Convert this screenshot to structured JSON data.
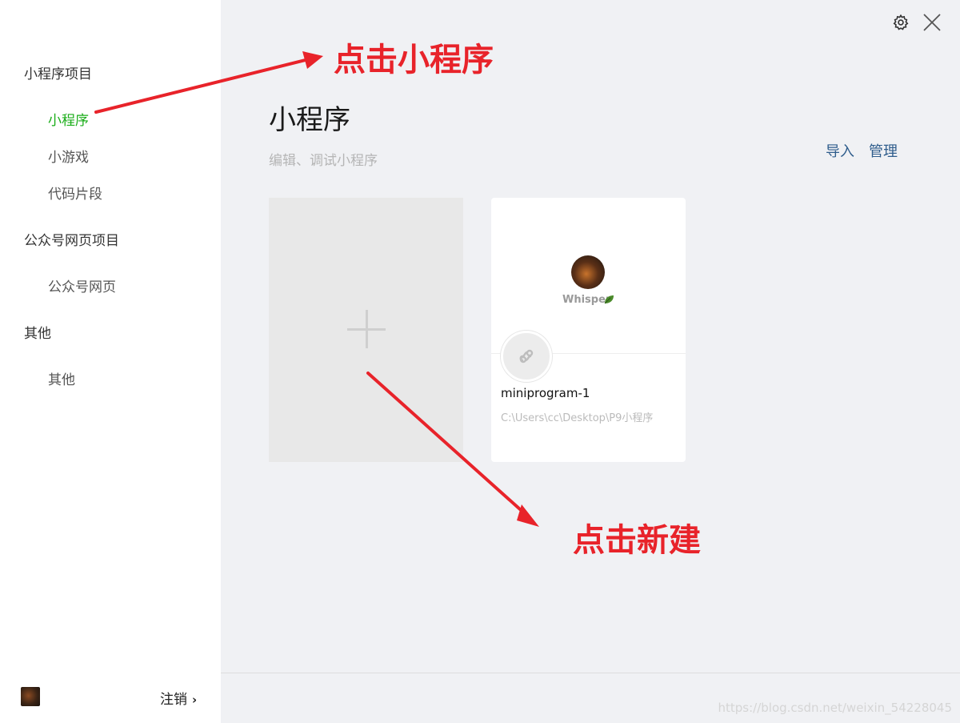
{
  "sidebar": {
    "groups": [
      {
        "label": "小程序项目",
        "items": [
          {
            "label": "小程序",
            "active": true
          },
          {
            "label": "小游戏"
          },
          {
            "label": "代码片段"
          }
        ]
      },
      {
        "label": "公众号网页项目",
        "items": [
          {
            "label": "公众号网页"
          }
        ]
      },
      {
        "label": "其他",
        "items": [
          {
            "label": "其他"
          }
        ]
      }
    ],
    "footer": {
      "logout_label": "注销",
      "avatar_icon": "user-avatar"
    }
  },
  "topbar": {
    "settings_icon": "gear-icon",
    "close_icon": "close-icon"
  },
  "main": {
    "title": "小程序",
    "subtitle": "编辑、调试小程序",
    "actions": {
      "import_label": "导入",
      "manage_label": "管理"
    },
    "new_card_icon": "plus-icon",
    "projects": [
      {
        "name": "miniprogram-1",
        "path": "C:\\Users\\cc\\Desktop\\P9小程序",
        "cover_brand": "Whisper"
      }
    ]
  },
  "annotations": {
    "arrow1_text": "点击小程序",
    "arrow2_text": "点击新建"
  },
  "watermark": "https://blog.csdn.net/weixin_54228045",
  "colors": {
    "accent_green": "#1aad19",
    "link_blue": "#2f5d8c",
    "annotation_red": "#e8232a",
    "bg_main": "#f0f1f4"
  }
}
